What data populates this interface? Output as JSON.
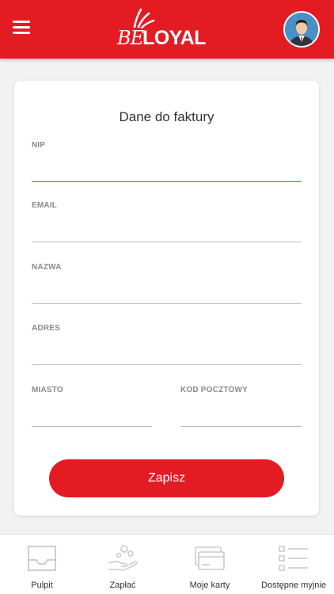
{
  "header": {
    "menu_icon": "hamburger-icon",
    "logo_be": "BE",
    "logo_loyal": "LOYAL",
    "avatar_icon": "user-avatar",
    "background_color": "#e31b23"
  },
  "form": {
    "title": "Dane do faktury",
    "fields": {
      "nip": {
        "label": "NIP",
        "value": ""
      },
      "email": {
        "label": "EMAIL",
        "value": ""
      },
      "nazwa": {
        "label": "NAZWA",
        "value": ""
      },
      "adres": {
        "label": "ADRES",
        "value": ""
      },
      "miasto": {
        "label": "MIASTO",
        "value": ""
      },
      "kod_pocztowy": {
        "label": "KOD POCZTOWY",
        "value": ""
      }
    },
    "save_label": "Zapisz",
    "active_field_color": "#3f8a3f"
  },
  "bottom_nav": {
    "items": [
      {
        "label": "Pulpit",
        "icon": "inbox-tray-icon"
      },
      {
        "label": "Zapłać",
        "icon": "hand-coins-icon"
      },
      {
        "label": "Moje karty",
        "icon": "cards-icon"
      },
      {
        "label": "Dostępne myjnie",
        "icon": "list-icon"
      }
    ]
  }
}
